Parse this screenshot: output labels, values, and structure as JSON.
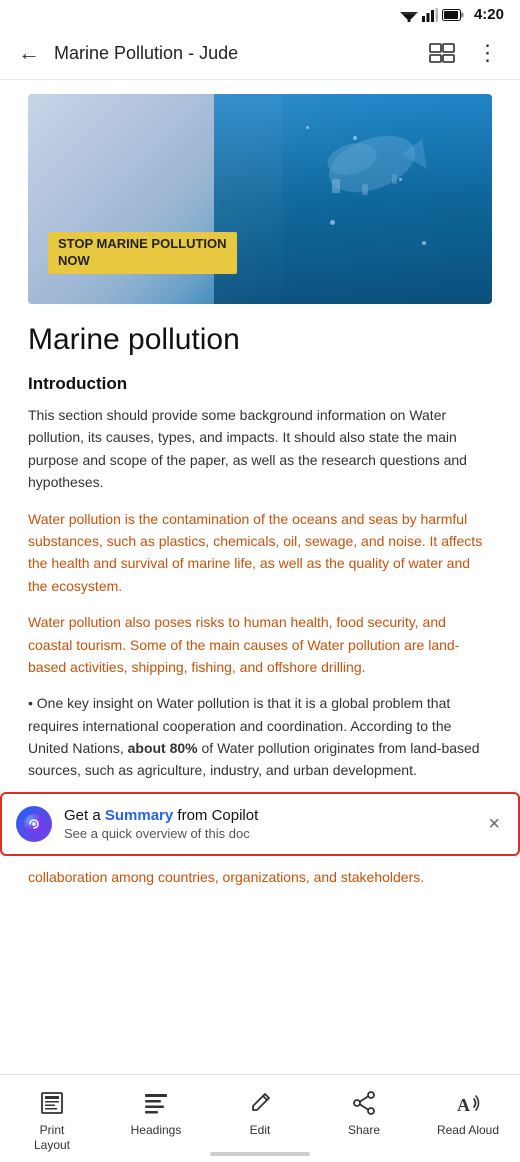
{
  "statusBar": {
    "time": "4:20"
  },
  "navBar": {
    "title": "Marine Pollution - Jude",
    "backLabel": "←",
    "moreLabel": "⋮"
  },
  "hero": {
    "bannerText1": "STOP MARINE POLLUTION",
    "bannerText2": "NOW"
  },
  "document": {
    "title": "Marine pollution",
    "sectionTitle": "Introduction",
    "para1": "This section should provide some background information on Water pollution, its causes, types, and impacts. It should also state the main purpose and scope of the paper, as well as the research questions and hypotheses.",
    "para2": "Water pollution is the contamination of the oceans and seas by harmful substances, such as plastics, chemicals, oil, sewage, and noise. It affects the health and survival of marine life, as well as the quality of water and the ecosystem.",
    "para3": "Water pollution also poses risks to human health, food security, and coastal tourism. Some of the main causes of Water pollution are land-based activities, shipping, fishing, and offshore drilling.",
    "para4Prefix": "• One key insight on Water pollution is that it is a global problem that requires international cooperation and coordination. According to the United Nations, ",
    "para4Bold": "about 80%",
    "para4Suffix": " of Water pollution originates from land-based sources, such as agriculture, industry, and urban development.",
    "para5Cut": "collaboration among countries, organizations, and stakeholders."
  },
  "copilotBanner": {
    "title1": "Get a ",
    "titleHighlight": "Summary",
    "title2": " from Copilot",
    "subtitle": "See a quick overview of this doc",
    "closeLabel": "×"
  },
  "toolbar": {
    "items": [
      {
        "id": "print-layout",
        "label": "Print\nLayout",
        "icon": "print-layout-icon"
      },
      {
        "id": "headings",
        "label": "Headings",
        "icon": "headings-icon"
      },
      {
        "id": "edit",
        "label": "Edit",
        "icon": "edit-icon"
      },
      {
        "id": "share",
        "label": "Share",
        "icon": "share-icon"
      },
      {
        "id": "read-aloud",
        "label": "Read Aloud",
        "icon": "read-aloud-icon"
      }
    ]
  }
}
